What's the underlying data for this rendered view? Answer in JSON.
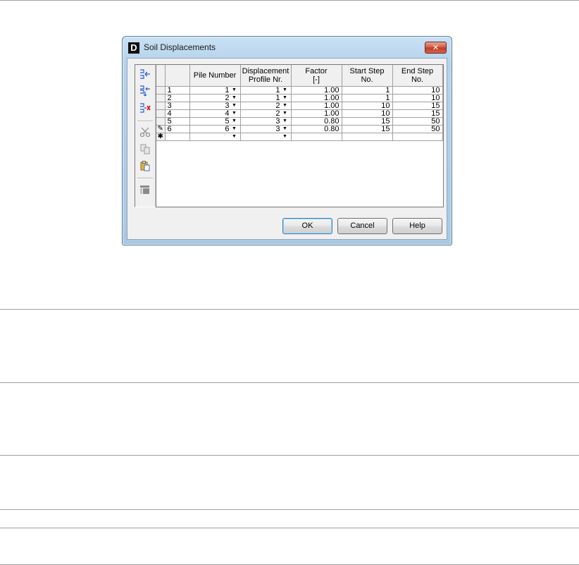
{
  "window": {
    "app_icon_letter": "D",
    "title": "Soil Displacements",
    "close_glyph": "✕"
  },
  "toolbar": {
    "icons": [
      "insert-row-icon",
      "insert-row-below-icon",
      "delete-row-icon",
      "cut-icon",
      "copy-icon",
      "paste-icon",
      "copy-block-icon"
    ]
  },
  "grid": {
    "columns": [
      "",
      "Pile Number",
      "Displacement Profile Nr.",
      "Factor [-]",
      "Start Step No.",
      "End Step No."
    ],
    "rows": [
      {
        "indicator": "",
        "no": "1",
        "pile": "1",
        "profile": "1",
        "factor": "1.00",
        "start": "1",
        "end": "10"
      },
      {
        "indicator": "",
        "no": "2",
        "pile": "2",
        "profile": "1",
        "factor": "1.00",
        "start": "1",
        "end": "10"
      },
      {
        "indicator": "",
        "no": "3",
        "pile": "3",
        "profile": "2",
        "factor": "1.00",
        "start": "10",
        "end": "15"
      },
      {
        "indicator": "",
        "no": "4",
        "pile": "4",
        "profile": "2",
        "factor": "1.00",
        "start": "10",
        "end": "15"
      },
      {
        "indicator": "",
        "no": "5",
        "pile": "5",
        "profile": "3",
        "factor": "0.80",
        "start": "15",
        "end": "50"
      },
      {
        "indicator": "✎",
        "no": "6",
        "pile": "6",
        "profile": "3",
        "factor": "0.80",
        "start": "15",
        "end": "50"
      },
      {
        "indicator": "✱",
        "no": "",
        "pile": "",
        "profile": "",
        "factor": "",
        "start": "",
        "end": ""
      }
    ],
    "dropdown_arrow": "▼"
  },
  "buttons": {
    "ok": "OK",
    "cancel": "Cancel",
    "help": "Help"
  },
  "colors": {
    "title_bar": "#b6d3ec",
    "close_button": "#c23a22",
    "default_button_border": "#3c7fb1"
  }
}
